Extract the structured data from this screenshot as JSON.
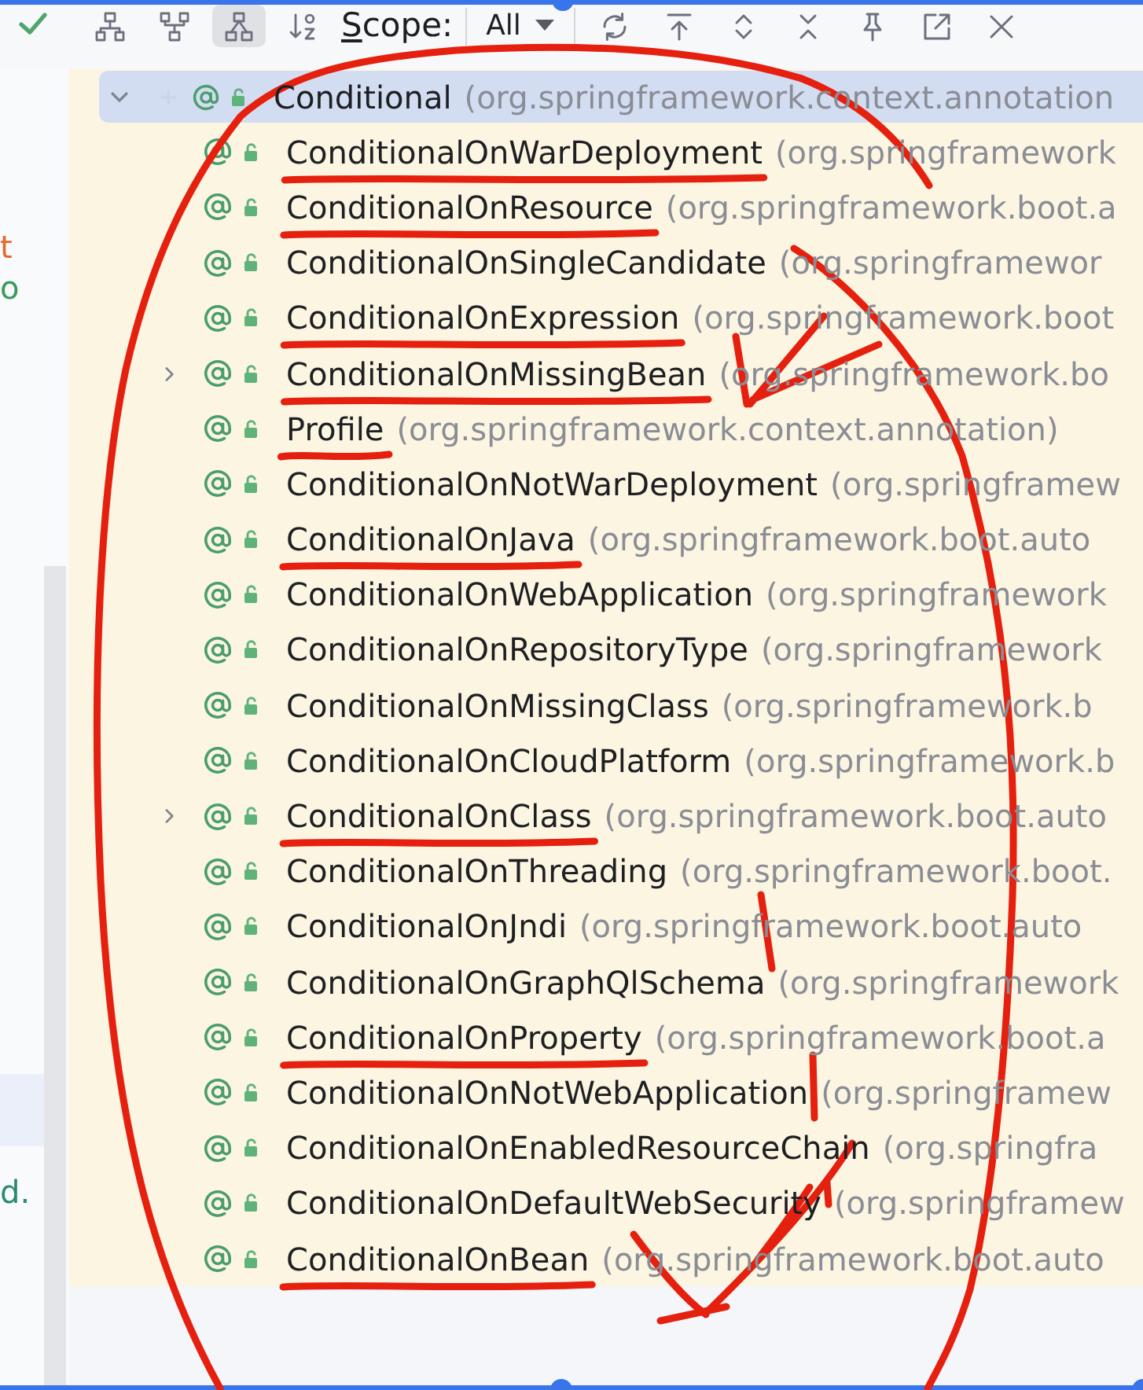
{
  "toolbar": {
    "view_modes": [
      {
        "kind": "supertypes",
        "selected": false
      },
      {
        "kind": "subtypes",
        "selected": false
      },
      {
        "kind": "hierarchy",
        "selected": true
      }
    ],
    "scope_label": "Scope:",
    "scope_value": "All"
  },
  "left_panel": {
    "upper": [
      {
        "text": "t",
        "color": "#e3692d"
      },
      {
        "text": "o",
        "color": "#3d9a5d"
      }
    ],
    "lower": [
      {
        "text": "d.",
        "color": "#2c8a6b"
      }
    ]
  },
  "tree": {
    "root": {
      "name": "Conditional",
      "package": "(org.springframework.context.annotation",
      "selected": true,
      "expanded": true,
      "children": [
        {
          "name": "ConditionalOnWarDeployment",
          "package": "(org.springframework",
          "selected": false,
          "expandable": false,
          "underlined": true
        },
        {
          "name": "ConditionalOnResource",
          "package": "(org.springframework.boot.a",
          "selected": false,
          "expandable": false,
          "underlined": true
        },
        {
          "name": "ConditionalOnSingleCandidate",
          "package": "(org.springframewor",
          "selected": false,
          "expandable": false,
          "underlined": false
        },
        {
          "name": "ConditionalOnExpression",
          "package": "(org.springframework.boot",
          "selected": false,
          "expandable": false,
          "underlined": true
        },
        {
          "name": "ConditionalOnMissingBean",
          "package": "(org.springframework.bo",
          "selected": false,
          "expandable": true,
          "underlined": true
        },
        {
          "name": "Profile",
          "package": "(org.springframework.context.annotation)",
          "selected": false,
          "expandable": false,
          "underlined": true
        },
        {
          "name": "ConditionalOnNotWarDeployment",
          "package": "(org.springframew",
          "selected": false,
          "expandable": false,
          "underlined": false
        },
        {
          "name": "ConditionalOnJava",
          "package": "(org.springframework.boot.auto",
          "selected": false,
          "expandable": false,
          "underlined": true
        },
        {
          "name": "ConditionalOnWebApplication",
          "package": "(org.springframework",
          "selected": false,
          "expandable": false,
          "underlined": false
        },
        {
          "name": "ConditionalOnRepositoryType",
          "package": "(org.springframework",
          "selected": false,
          "expandable": false,
          "underlined": false
        },
        {
          "name": "ConditionalOnMissingClass",
          "package": "(org.springframework.b",
          "selected": false,
          "expandable": false,
          "underlined": false
        },
        {
          "name": "ConditionalOnCloudPlatform",
          "package": "(org.springframework.b",
          "selected": false,
          "expandable": false,
          "underlined": false
        },
        {
          "name": "ConditionalOnClass",
          "package": "(org.springframework.boot.auto",
          "selected": false,
          "expandable": true,
          "underlined": true
        },
        {
          "name": "ConditionalOnThreading",
          "package": "(org.springframework.boot.",
          "selected": false,
          "expandable": false,
          "underlined": false
        },
        {
          "name": "ConditionalOnJndi",
          "package": "(org.springframework.boot.auto",
          "selected": false,
          "expandable": false,
          "underlined": false
        },
        {
          "name": "ConditionalOnGraphQlSchema",
          "package": "(org.springframework",
          "selected": false,
          "expandable": false,
          "underlined": false
        },
        {
          "name": "ConditionalOnProperty",
          "package": "(org.springframework.boot.a",
          "selected": false,
          "expandable": false,
          "underlined": true
        },
        {
          "name": "ConditionalOnNotWebApplication",
          "package": "(org.springframew",
          "selected": false,
          "expandable": false,
          "underlined": false
        },
        {
          "name": "ConditionalOnEnabledResourceChain",
          "package": "(org.springfra",
          "selected": false,
          "expandable": false,
          "underlined": false
        },
        {
          "name": "ConditionalOnDefaultWebSecurity",
          "package": "(org.springframew",
          "selected": false,
          "expandable": false,
          "underlined": false
        },
        {
          "name": "ConditionalOnBean",
          "package": "(org.springframework.boot.auto",
          "selected": false,
          "expandable": false,
          "underlined": true
        }
      ]
    }
  }
}
